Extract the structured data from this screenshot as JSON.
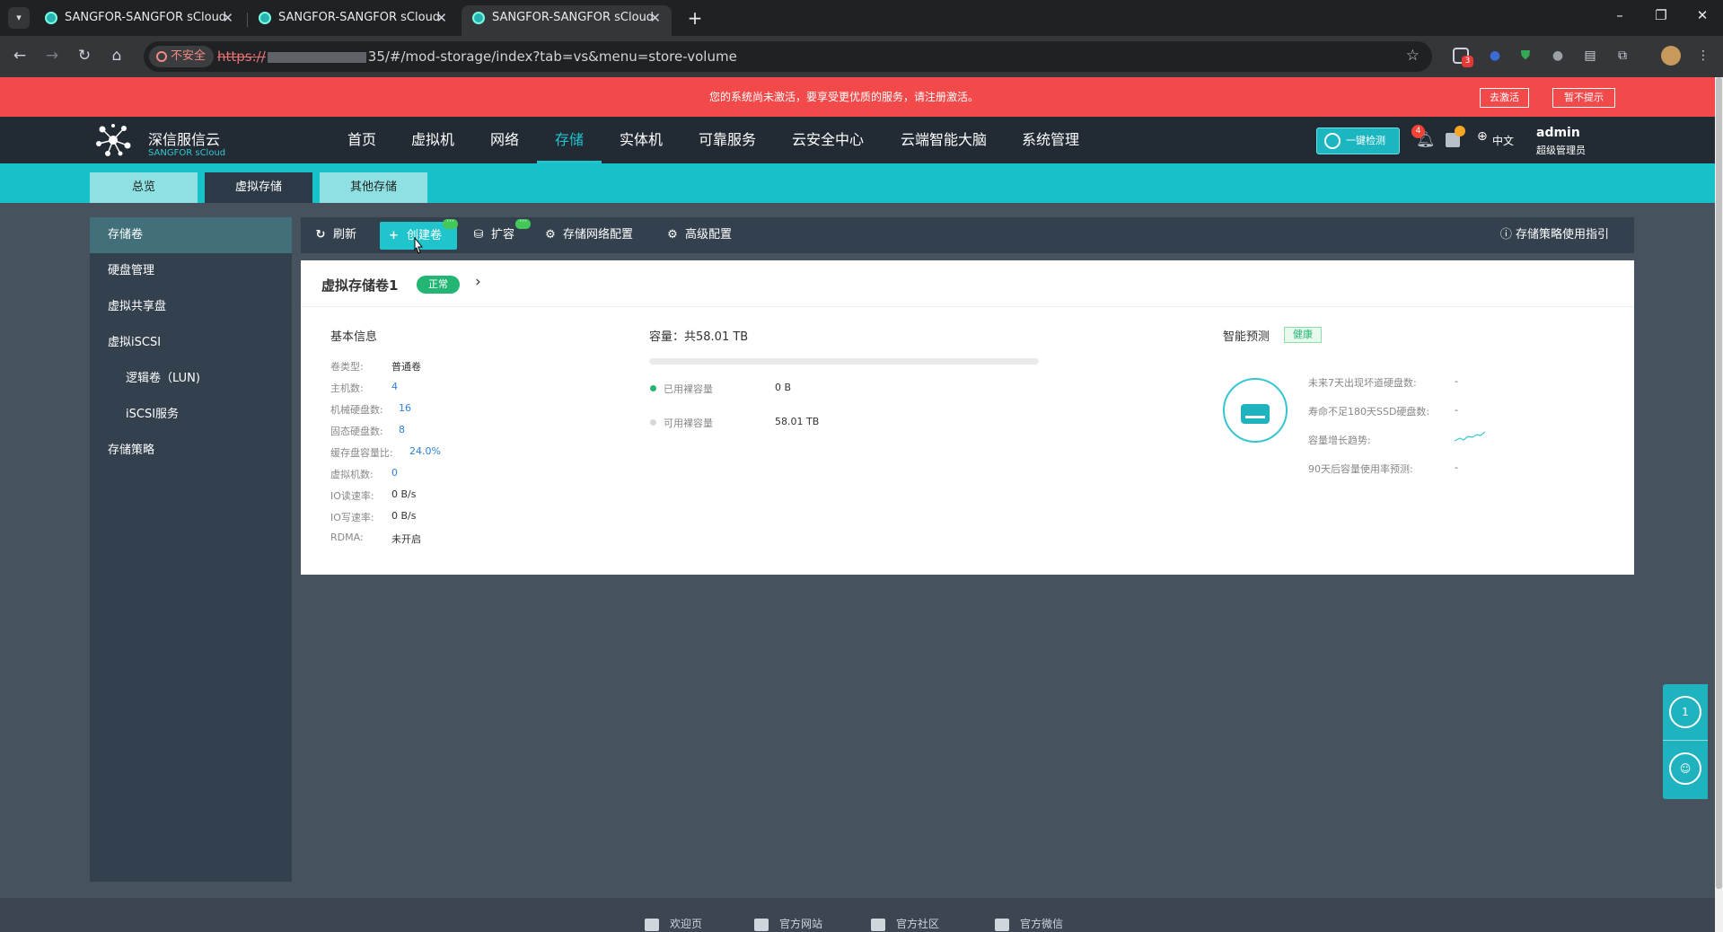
{
  "browser": {
    "tabs": [
      {
        "title": "SANGFOR-SANGFOR sCloud"
      },
      {
        "title": "SANGFOR-SANGFOR sCloud"
      },
      {
        "title": "SANGFOR-SANGFOR sCloud"
      }
    ],
    "new_tab": "+",
    "insecure_label": "不安全",
    "url_scheme": "https://",
    "url_rest": "35/#/mod-storage/index?tab=vs&menu=store-volume",
    "ext_badge": "3"
  },
  "banner": {
    "text": "您的系统尚未激活，要享受更优质的服务，请注册激活。",
    "activate_btn": "去激活",
    "dismiss_btn": "暂不提示"
  },
  "header": {
    "logo_cn": "深信服信云",
    "logo_en": "SANGFOR sCloud",
    "nav": [
      "首页",
      "虚拟机",
      "网络",
      "存储",
      "实体机",
      "可靠服务",
      "云安全中心",
      "云端智能大脑",
      "系统管理"
    ],
    "active_nav": "存储",
    "check_btn": "一键检测",
    "bell_count": "4",
    "lang": "中文",
    "user": "admin",
    "role": "超级管理员"
  },
  "subnav": {
    "tabs": [
      "总览",
      "虚拟存储",
      "其他存储"
    ]
  },
  "sidebar": {
    "items": [
      "存储卷",
      "硬盘管理",
      "虚拟共享盘",
      "虚拟iSCSI",
      "逻辑卷（LUN)",
      "iSCSI服务",
      "存储策略"
    ]
  },
  "toolbar": {
    "refresh": "刷新",
    "create": "创建卷",
    "expand": "扩容",
    "net_config": "存储网络配置",
    "adv_config": "高级配置",
    "guide": "存储策略使用指引",
    "more_badge": "···"
  },
  "volume": {
    "name": "虚拟存储卷1",
    "status": "正常",
    "basic_title": "基本信息",
    "info": [
      {
        "label": "卷类型:",
        "value": "普通卷",
        "link": false
      },
      {
        "label": "主机数:",
        "value": "4",
        "link": true
      },
      {
        "label": "机械硬盘数:",
        "value": "16",
        "link": true
      },
      {
        "label": "固态硬盘数:",
        "value": "8",
        "link": true
      },
      {
        "label": "缓存盘容量比:",
        "value": "24.0%",
        "link": true
      },
      {
        "label": "虚拟机数:",
        "value": "0",
        "link": true
      },
      {
        "label": "IO读速率:",
        "value": "0 B/s",
        "link": false
      },
      {
        "label": "IO写速率:",
        "value": "0 B/s",
        "link": false
      },
      {
        "label": "RDMA:",
        "value": "未开启",
        "link": false
      }
    ],
    "capacity_title": "容量：共58.01 TB",
    "capacity_used_fraction": 0,
    "used_label": "已用裸容量",
    "used_value": "0 B",
    "free_label": "可用裸容量",
    "free_value": "58.01 TB",
    "used_color": "#22b573",
    "free_color": "#d8d8d8",
    "predict_title": "智能预测",
    "health": "健康",
    "predictions": [
      {
        "label": "未来7天出现坏道硬盘数:",
        "value": "-"
      },
      {
        "label": "寿命不足180天SSD硬盘数:",
        "value": "-"
      },
      {
        "label": "容量增长趋势:",
        "value": ""
      },
      {
        "label": "90天后容量使用率预测:",
        "value": "-"
      }
    ]
  },
  "float": {
    "step": "1"
  },
  "footer": {
    "links": [
      "欢迎页",
      "官方网站",
      "官方社区",
      "官方微信"
    ]
  },
  "colors": {
    "accent": "#1fc4cc",
    "banner": "#f24a4a",
    "header": "#222a33",
    "ok": "#22b573"
  }
}
